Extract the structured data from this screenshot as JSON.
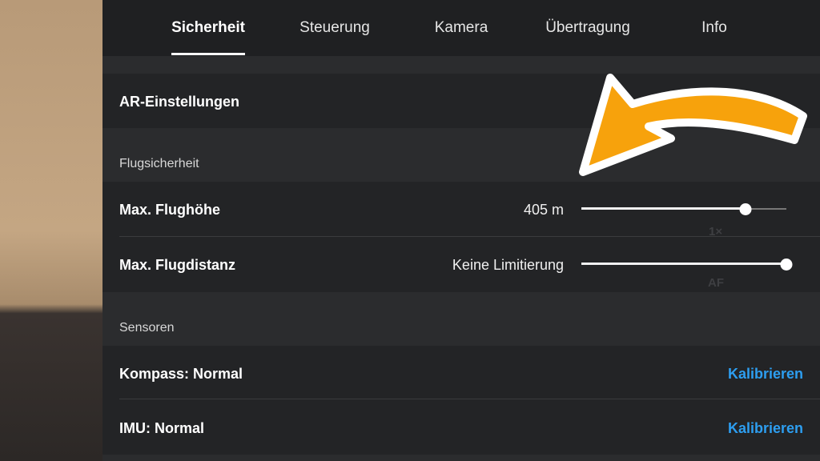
{
  "tabs": [
    {
      "label": "Sicherheit",
      "active": true
    },
    {
      "label": "Steuerung"
    },
    {
      "label": "Kamera"
    },
    {
      "label": "Übertragung"
    },
    {
      "label": "Info"
    }
  ],
  "ar_settings": {
    "label": "AR-Einstellungen"
  },
  "flight_safety": {
    "section_title": "Flugsicherheit",
    "max_height": {
      "label": "Max. Flughöhe",
      "value": "405 m",
      "slider_fraction": 0.8
    },
    "max_distance": {
      "label": "Max. Flugdistanz",
      "value": "Keine Limitierung",
      "slider_fraction": 1.0
    }
  },
  "sensors": {
    "section_title": "Sensoren",
    "compass": {
      "label": "Kompass: Normal",
      "action": "Kalibrieren"
    },
    "imu": {
      "label": "IMU: Normal",
      "action": "Kalibrieren"
    }
  },
  "background_overlay": {
    "zoom": "1×",
    "focus": "AF"
  },
  "colors": {
    "accent_link": "#2d9ef0",
    "arrow": "#f7a20c"
  }
}
